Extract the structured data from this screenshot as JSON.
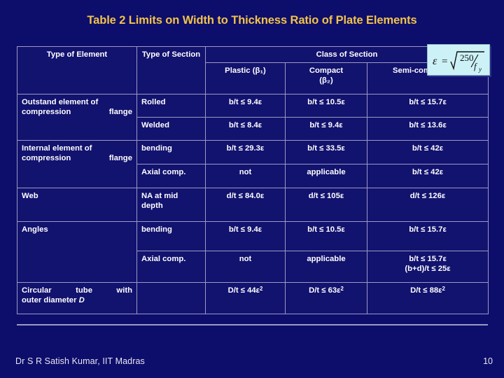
{
  "slide": {
    "title": "Table 2 Limits on Width to Thickness Ratio of Plate Elements",
    "background_color": "#0d0d6b",
    "title_color": "#f2c349"
  },
  "formula": {
    "label": "epsilon-equals-sqrt-250-over-fy",
    "epsilon": "ε",
    "equals": "=",
    "numerator": "250",
    "denominator": "f",
    "denominator_sub": "y",
    "background_color": "#ccf2f7"
  },
  "table": {
    "headers": {
      "type_of_element": "Type of Element",
      "type_of_section": "Type of Section",
      "class_of_section": "Class of Section",
      "plastic": "Plastic (β₁)",
      "compact_line1": "Compact",
      "compact_line2": "(β₂)",
      "semi_compact": "Semi-compact (β₃)"
    },
    "rows": [
      {
        "element": "Outstand element of compression flange",
        "element_rowspan": 2,
        "section": "Rolled",
        "plastic": "b/t ≤ 9.4ε",
        "compact": "b/t ≤ 10.5ε",
        "semi_compact": "b/t ≤ 15.7ε"
      },
      {
        "element": "",
        "section": "Welded",
        "plastic": "b/t ≤ 8.4ε",
        "compact": "b/t ≤ 9.4ε",
        "semi_compact": "b/t ≤ 13.6ε"
      },
      {
        "element": "Internal element of compression flange",
        "element_rowspan": 2,
        "section": "bending",
        "plastic": "b/t ≤ 29.3ε",
        "compact": "b/t ≤ 33.5ε",
        "semi_compact": "b/t ≤ 42ε"
      },
      {
        "element": "",
        "section": "Axial comp.",
        "plastic": "not",
        "compact": "applicable",
        "semi_compact": "b/t ≤ 42ε"
      },
      {
        "element": "Web",
        "section": "NA at mid depth",
        "plastic": "d/t ≤ 84.0ε",
        "compact": "d/t ≤ 105ε",
        "semi_compact": "d/t ≤ 126ε"
      },
      {
        "element": "Angles",
        "element_rowspan": 2,
        "section": "bending",
        "plastic": "b/t ≤ 9.4ε",
        "compact": "b/t ≤ 10.5ε",
        "semi_compact": "b/t ≤ 15.7ε"
      },
      {
        "element": "",
        "section": "Axial comp.",
        "plastic": "not",
        "compact": "applicable",
        "semi_compact_line1": "b/t ≤ 15.7ε",
        "semi_compact_line2": "(b+d)/t ≤ 25ε"
      },
      {
        "element_line1": "Circular tube with",
        "element_line2_prefix": "outer diameter ",
        "element_line2_italic": "D",
        "section": "",
        "plastic": "D/t ≤ 44ε",
        "plastic_sup": "2",
        "compact": "D/t ≤ 63ε",
        "compact_sup": "2",
        "semi_compact": "D/t ≤ 88ε",
        "semi_compact_sup": "2"
      }
    ]
  },
  "footer": {
    "author": "Dr S R Satish Kumar, IIT Madras",
    "page_number": "10"
  }
}
